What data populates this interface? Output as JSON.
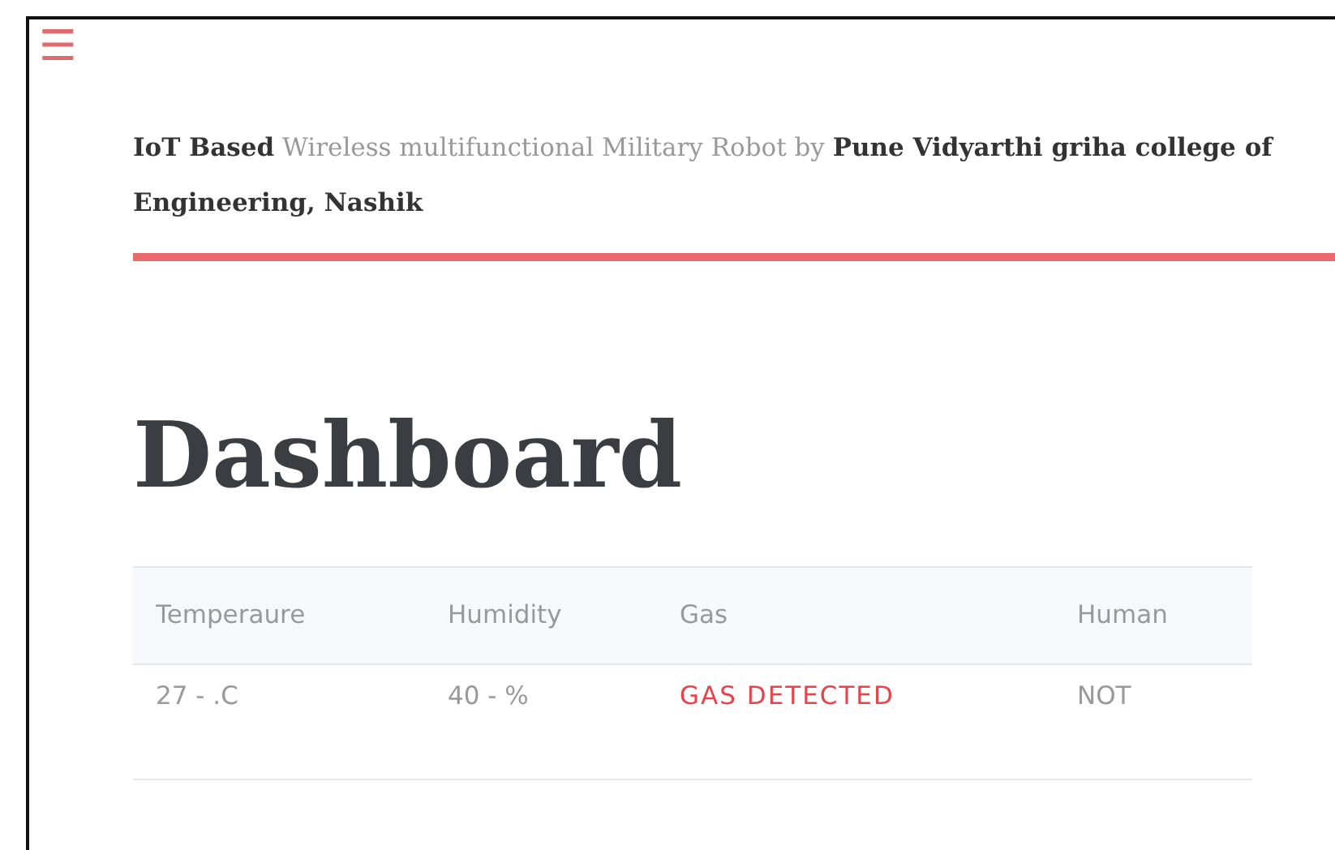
{
  "menu": {
    "icon": "☰"
  },
  "header": {
    "text": "**IoT Based** Wireless multifunctional Military Robot by **Pune Vidyarthi griha college of Engineering, Nashik**"
  },
  "title": "Dashboard",
  "table": {
    "columns": [
      "Temperaure",
      "Humidity",
      "Gas",
      "Human"
    ],
    "rows": [
      [
        {
          "text": "27 - .C",
          "kind": "plain"
        },
        {
          "text": "40 - %",
          "kind": "plain"
        },
        {
          "text": "GAS DETECTED",
          "kind": "alert"
        },
        {
          "text": "NOT",
          "kind": "plain"
        }
      ]
    ]
  }
}
